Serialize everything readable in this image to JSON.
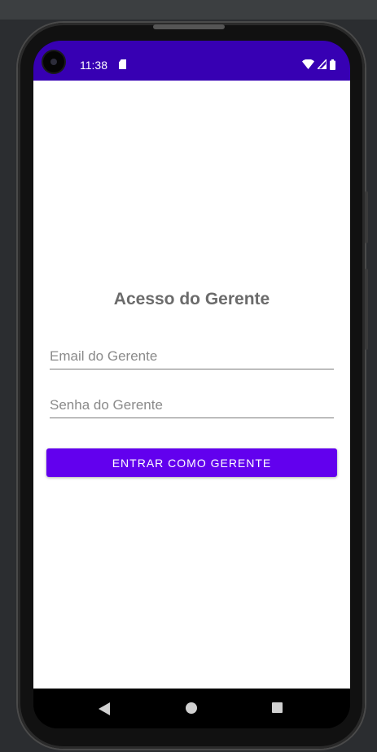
{
  "status_bar": {
    "time": "11:38",
    "background": "#3700b3",
    "icons": [
      "sd-card-icon",
      "wifi-icon",
      "signal-icon",
      "battery-icon"
    ]
  },
  "login": {
    "title": "Acesso do Gerente",
    "email_placeholder": "Email do Gerente",
    "email_value": "",
    "password_placeholder": "Senha do Gerente",
    "password_value": "",
    "submit_label": "ENTRAR COMO GERENTE",
    "accent": "#6200ee"
  },
  "nav_bar": {
    "buttons": [
      "back-icon",
      "home-icon",
      "recents-icon"
    ]
  }
}
